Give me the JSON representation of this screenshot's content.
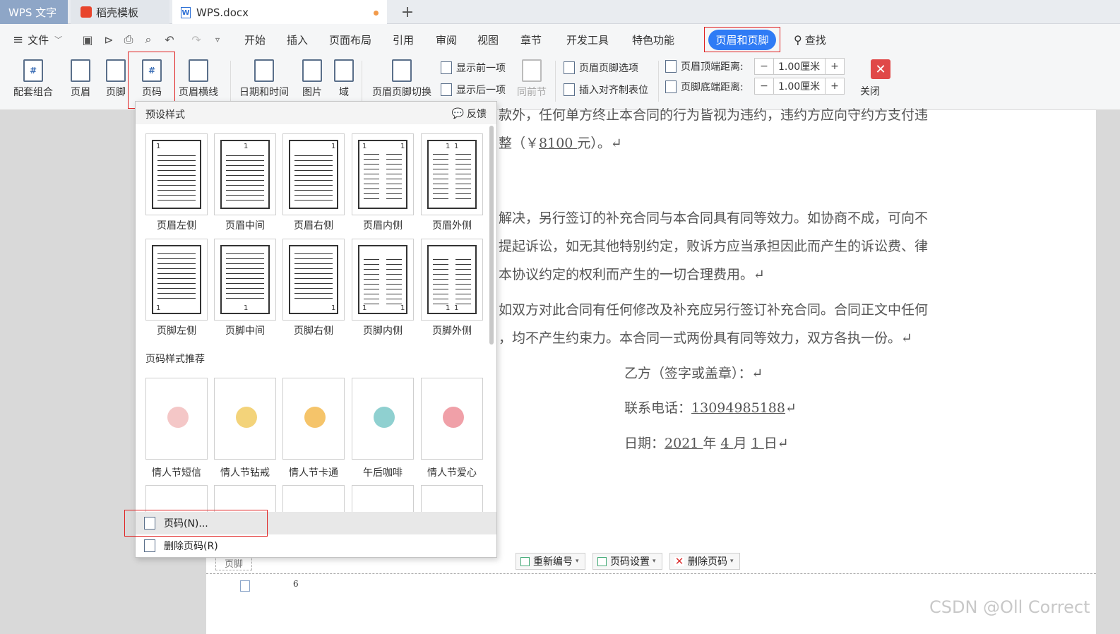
{
  "tabs": [
    {
      "label": "WPS 文字"
    },
    {
      "label": "稻壳模板"
    },
    {
      "label": "WPS.docx"
    }
  ],
  "new_tab": "+",
  "menu": {
    "file": "文件",
    "items": [
      "开始",
      "插入",
      "页面布局",
      "引用",
      "审阅",
      "视图",
      "章节",
      "开发工具",
      "特色功能"
    ],
    "active": "页眉和页脚",
    "search": "查找"
  },
  "ribbon": {
    "combo": "配套组合",
    "header": "页眉",
    "footer": "页脚",
    "page_number": "页码",
    "header_line": "页眉横线",
    "datetime": "日期和时间",
    "picture": "图片",
    "field": "域",
    "switch": "页眉页脚切换",
    "show_prev": "显示前一项",
    "show_next": "显示后一项",
    "same_prev": "同前节",
    "hf_options": "页眉页脚选项",
    "insert_tab": "插入对齐制表位",
    "header_top_label": "页眉顶端距离:",
    "header_top_value": "1.00厘米",
    "footer_bottom_label": "页脚底端距离:",
    "footer_bottom_value": "1.00厘米",
    "close": "关闭"
  },
  "dropdown": {
    "title": "预设样式",
    "feedback": "反馈",
    "presets": [
      {
        "label": "页眉左侧"
      },
      {
        "label": "页眉中间"
      },
      {
        "label": "页眉右侧"
      },
      {
        "label": "页眉内侧"
      },
      {
        "label": "页眉外侧"
      },
      {
        "label": "页脚左侧"
      },
      {
        "label": "页脚中间"
      },
      {
        "label": "页脚右侧"
      },
      {
        "label": "页脚内侧"
      },
      {
        "label": "页脚外侧"
      }
    ],
    "page_num_digit": "1",
    "recommend_title": "页码样式推荐",
    "recommend": [
      {
        "label": "情人节短信"
      },
      {
        "label": "情人节钻戒"
      },
      {
        "label": "情人节卡通"
      },
      {
        "label": "午后咖啡"
      },
      {
        "label": "情人节爱心"
      }
    ],
    "page_number_item": "页码(N)...",
    "delete_item": "删除页码(R)"
  },
  "document": {
    "line1": "款外，任何单方终止本合同的行为皆视为违约，违约方应向守约方支付违",
    "line2_pre": "整（￥",
    "line2_amount": "8100 ",
    "line2_post": "元）。↵",
    "line3": "解决，另行签订的补充合同与本合同具有同等效力。如协商不成，可向不",
    "line4": "提起诉讼，如无其他特别约定，败诉方应当承担因此而产生的诉讼费、律",
    "line5": "本协议约定的权利而产生的一切合理费用。↵",
    "line6": "如双方对此合同有任何修改及补充应另行签订补充合同。合同正文中任何",
    "line7": "，均不产生约束力。本合同一式两份具有同等效力，双方各执一份。↵",
    "party_b": "乙方（签字或盖章）：↵",
    "phone_label": "联系电话：",
    "phone": "13094985188",
    "date_label": "日期：",
    "date_year": "2021 ",
    "date_year_unit": "年 ",
    "date_month": "4 ",
    "date_month_unit": "月 ",
    "date_day": "1 ",
    "date_day_unit": "日↵"
  },
  "footer": {
    "tag": "页脚",
    "renumber": "重新编号",
    "page_setup": "页码设置",
    "delete": "删除页码",
    "page_num": "6"
  },
  "watermark": "CSDN @Oll Correct",
  "colors": {
    "accent": "#2f7bf5",
    "highlight_box": "#e02020",
    "close": "#e04848"
  }
}
